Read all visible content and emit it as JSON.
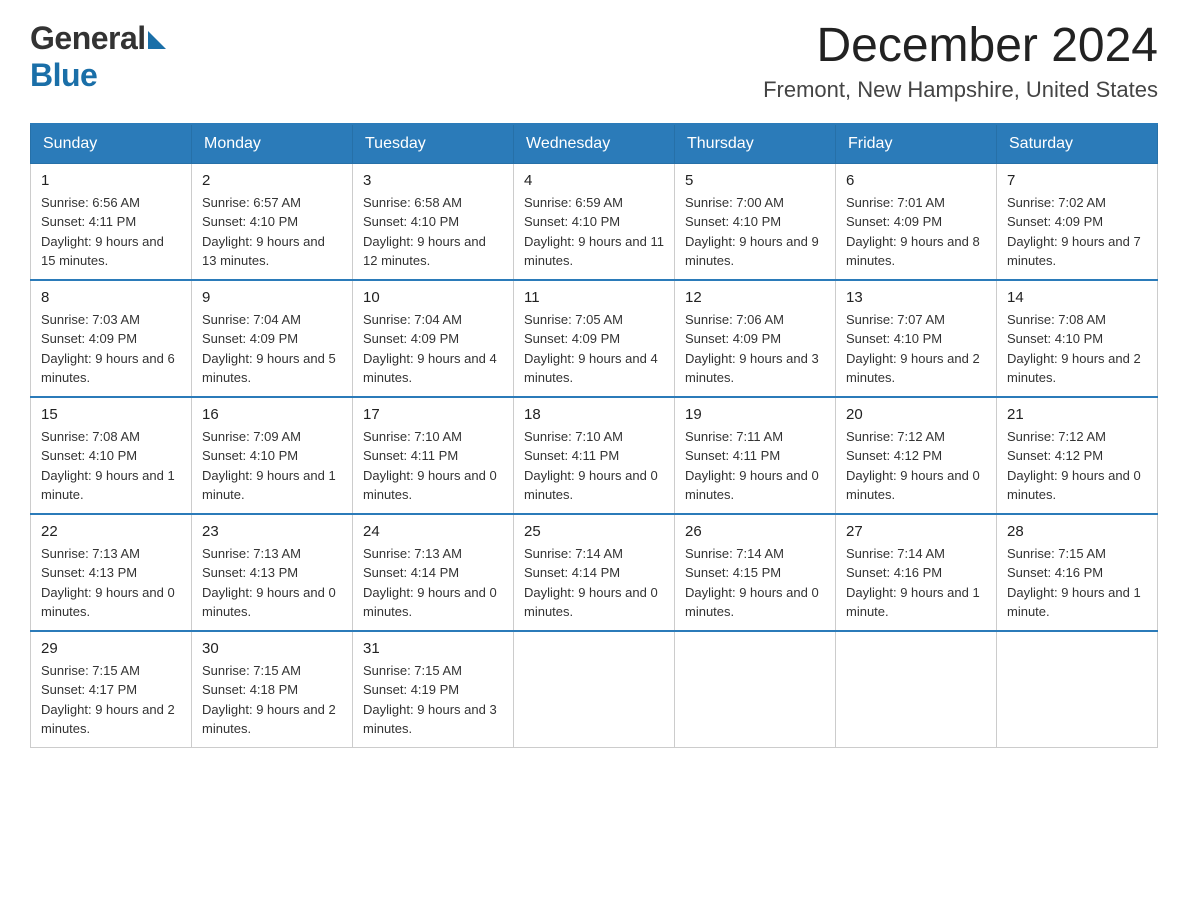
{
  "header": {
    "title": "December 2024",
    "subtitle": "Fremont, New Hampshire, United States",
    "logo_general": "General",
    "logo_blue": "Blue"
  },
  "days_of_week": [
    "Sunday",
    "Monday",
    "Tuesday",
    "Wednesday",
    "Thursday",
    "Friday",
    "Saturday"
  ],
  "weeks": [
    [
      {
        "day": "1",
        "sunrise": "6:56 AM",
        "sunset": "4:11 PM",
        "daylight": "9 hours and 15 minutes."
      },
      {
        "day": "2",
        "sunrise": "6:57 AM",
        "sunset": "4:10 PM",
        "daylight": "9 hours and 13 minutes."
      },
      {
        "day": "3",
        "sunrise": "6:58 AM",
        "sunset": "4:10 PM",
        "daylight": "9 hours and 12 minutes."
      },
      {
        "day": "4",
        "sunrise": "6:59 AM",
        "sunset": "4:10 PM",
        "daylight": "9 hours and 11 minutes."
      },
      {
        "day": "5",
        "sunrise": "7:00 AM",
        "sunset": "4:10 PM",
        "daylight": "9 hours and 9 minutes."
      },
      {
        "day": "6",
        "sunrise": "7:01 AM",
        "sunset": "4:09 PM",
        "daylight": "9 hours and 8 minutes."
      },
      {
        "day": "7",
        "sunrise": "7:02 AM",
        "sunset": "4:09 PM",
        "daylight": "9 hours and 7 minutes."
      }
    ],
    [
      {
        "day": "8",
        "sunrise": "7:03 AM",
        "sunset": "4:09 PM",
        "daylight": "9 hours and 6 minutes."
      },
      {
        "day": "9",
        "sunrise": "7:04 AM",
        "sunset": "4:09 PM",
        "daylight": "9 hours and 5 minutes."
      },
      {
        "day": "10",
        "sunrise": "7:04 AM",
        "sunset": "4:09 PM",
        "daylight": "9 hours and 4 minutes."
      },
      {
        "day": "11",
        "sunrise": "7:05 AM",
        "sunset": "4:09 PM",
        "daylight": "9 hours and 4 minutes."
      },
      {
        "day": "12",
        "sunrise": "7:06 AM",
        "sunset": "4:09 PM",
        "daylight": "9 hours and 3 minutes."
      },
      {
        "day": "13",
        "sunrise": "7:07 AM",
        "sunset": "4:10 PM",
        "daylight": "9 hours and 2 minutes."
      },
      {
        "day": "14",
        "sunrise": "7:08 AM",
        "sunset": "4:10 PM",
        "daylight": "9 hours and 2 minutes."
      }
    ],
    [
      {
        "day": "15",
        "sunrise": "7:08 AM",
        "sunset": "4:10 PM",
        "daylight": "9 hours and 1 minute."
      },
      {
        "day": "16",
        "sunrise": "7:09 AM",
        "sunset": "4:10 PM",
        "daylight": "9 hours and 1 minute."
      },
      {
        "day": "17",
        "sunrise": "7:10 AM",
        "sunset": "4:11 PM",
        "daylight": "9 hours and 0 minutes."
      },
      {
        "day": "18",
        "sunrise": "7:10 AM",
        "sunset": "4:11 PM",
        "daylight": "9 hours and 0 minutes."
      },
      {
        "day": "19",
        "sunrise": "7:11 AM",
        "sunset": "4:11 PM",
        "daylight": "9 hours and 0 minutes."
      },
      {
        "day": "20",
        "sunrise": "7:12 AM",
        "sunset": "4:12 PM",
        "daylight": "9 hours and 0 minutes."
      },
      {
        "day": "21",
        "sunrise": "7:12 AM",
        "sunset": "4:12 PM",
        "daylight": "9 hours and 0 minutes."
      }
    ],
    [
      {
        "day": "22",
        "sunrise": "7:13 AM",
        "sunset": "4:13 PM",
        "daylight": "9 hours and 0 minutes."
      },
      {
        "day": "23",
        "sunrise": "7:13 AM",
        "sunset": "4:13 PM",
        "daylight": "9 hours and 0 minutes."
      },
      {
        "day": "24",
        "sunrise": "7:13 AM",
        "sunset": "4:14 PM",
        "daylight": "9 hours and 0 minutes."
      },
      {
        "day": "25",
        "sunrise": "7:14 AM",
        "sunset": "4:14 PM",
        "daylight": "9 hours and 0 minutes."
      },
      {
        "day": "26",
        "sunrise": "7:14 AM",
        "sunset": "4:15 PM",
        "daylight": "9 hours and 0 minutes."
      },
      {
        "day": "27",
        "sunrise": "7:14 AM",
        "sunset": "4:16 PM",
        "daylight": "9 hours and 1 minute."
      },
      {
        "day": "28",
        "sunrise": "7:15 AM",
        "sunset": "4:16 PM",
        "daylight": "9 hours and 1 minute."
      }
    ],
    [
      {
        "day": "29",
        "sunrise": "7:15 AM",
        "sunset": "4:17 PM",
        "daylight": "9 hours and 2 minutes."
      },
      {
        "day": "30",
        "sunrise": "7:15 AM",
        "sunset": "4:18 PM",
        "daylight": "9 hours and 2 minutes."
      },
      {
        "day": "31",
        "sunrise": "7:15 AM",
        "sunset": "4:19 PM",
        "daylight": "9 hours and 3 minutes."
      },
      null,
      null,
      null,
      null
    ]
  ]
}
